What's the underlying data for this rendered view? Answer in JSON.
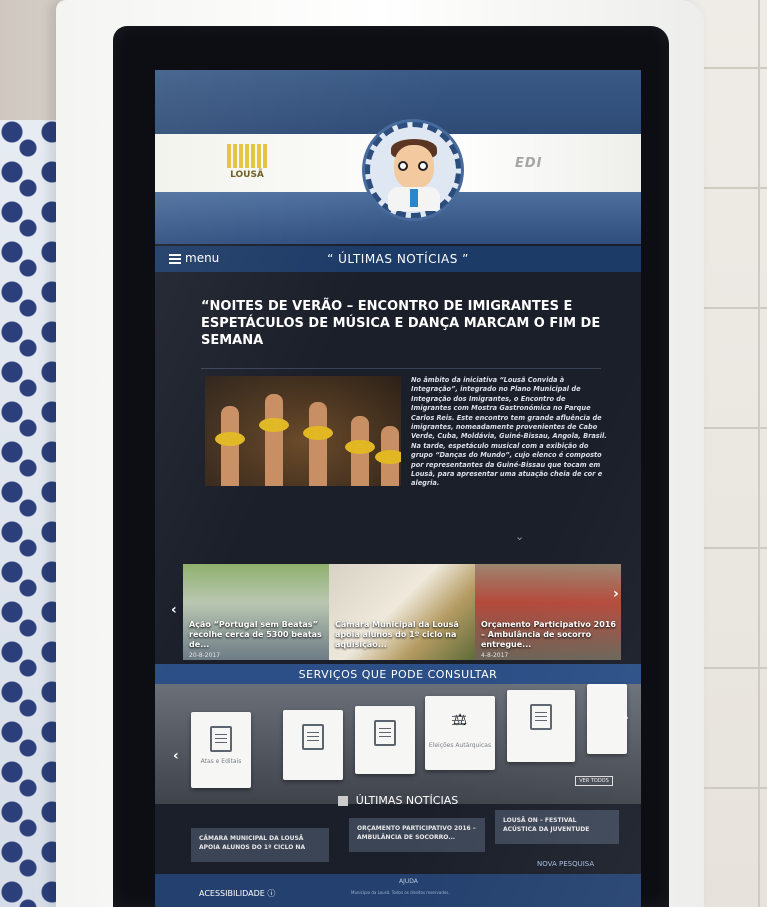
{
  "header": {
    "left_logo_text": "LOUSÃ",
    "right_logo_grey": "EDI",
    "right_logo_gold": ""
  },
  "nav": {
    "menu_label": "menu",
    "section_title": "“ ÚLTIMAS NOTÍCIAS ”"
  },
  "article": {
    "title": "“NOITES DE VERÃO – ENCONTRO DE IMIGRANTES E ESPETÁCULOS DE MÚSICA E DANÇA MARCAM O FIM DE SEMANA",
    "body": "No âmbito da iniciativa “Lousã Convida à Integração”, integrado no Plano Municipal de Integração dos Imigrantes, o Encontro de Imigrantes com Mostra Gastronómica no Parque Carlos Reis. Este encontro tem grande afluência de imigrantes, nomeadamente provenientes de Cabo Verde, Cuba, Moldávia, Guiné-Bissau, Angola, Brasil. Na tarde, espetáculo musical com a exibição do grupo “Danças do Mundo”, cujo elenco é composto por representantes da Guiné-Bissau que tocam em Lousã, para apresentar uma atuação cheia de cor e alegria.",
    "more_icon": "chevron-down-icon"
  },
  "carousel": {
    "items": [
      {
        "caption": "Ação “Portugal sem Beatas” recolhe cerca de 5300 beatas de...",
        "date": "20-8-2017"
      },
      {
        "caption": "Câmara Municipal da Lousã apoia alunos do 1º ciclo na aquisição...",
        "date": "7-8-2017"
      },
      {
        "caption": "Orçamento Participativo 2016 – Ambulância de socorro entregue...",
        "date": "4-8-2017"
      }
    ]
  },
  "services": {
    "title": "SERVIÇOS QUE PODE CONSULTAR",
    "tiles": [
      {
        "label": "Atas e Editais",
        "icon": "document-icon"
      },
      {
        "label": "",
        "icon": "document-icon"
      },
      {
        "label": "",
        "icon": "document-icon"
      },
      {
        "label": "Eleições Autárquicas",
        "icon": "scales-icon"
      },
      {
        "label": "",
        "icon": "info-document-icon"
      }
    ],
    "ver_todos": "VER TODOS"
  },
  "latest": {
    "title": "ÚLTIMAS NOTÍCIAS",
    "cards": [
      "CÂMARA MUNICIPAL DA LOUSÃ APOIA ALUNOS DO 1º CICLO NA",
      "ORÇAMENTO PARTICIPATIVO 2016 – AMBULÂNCIA DE SOCORRO...",
      "LOUSÃ ON – FESTIVAL ACÚSTICA DA JUVENTUDE"
    ],
    "new_search": "NOVA PESQUISA"
  },
  "footer": {
    "help": "AJUDA",
    "accessibility": "ACESSIBILIDADE",
    "copyright": "Município da Lousã. Todos os direitos reservados."
  },
  "colors": {
    "header_blue": "#2e4b76",
    "nav_blue": "#1d3b67",
    "section_blue": "#2b4f86",
    "screen_bg": "#1b1f2a"
  }
}
